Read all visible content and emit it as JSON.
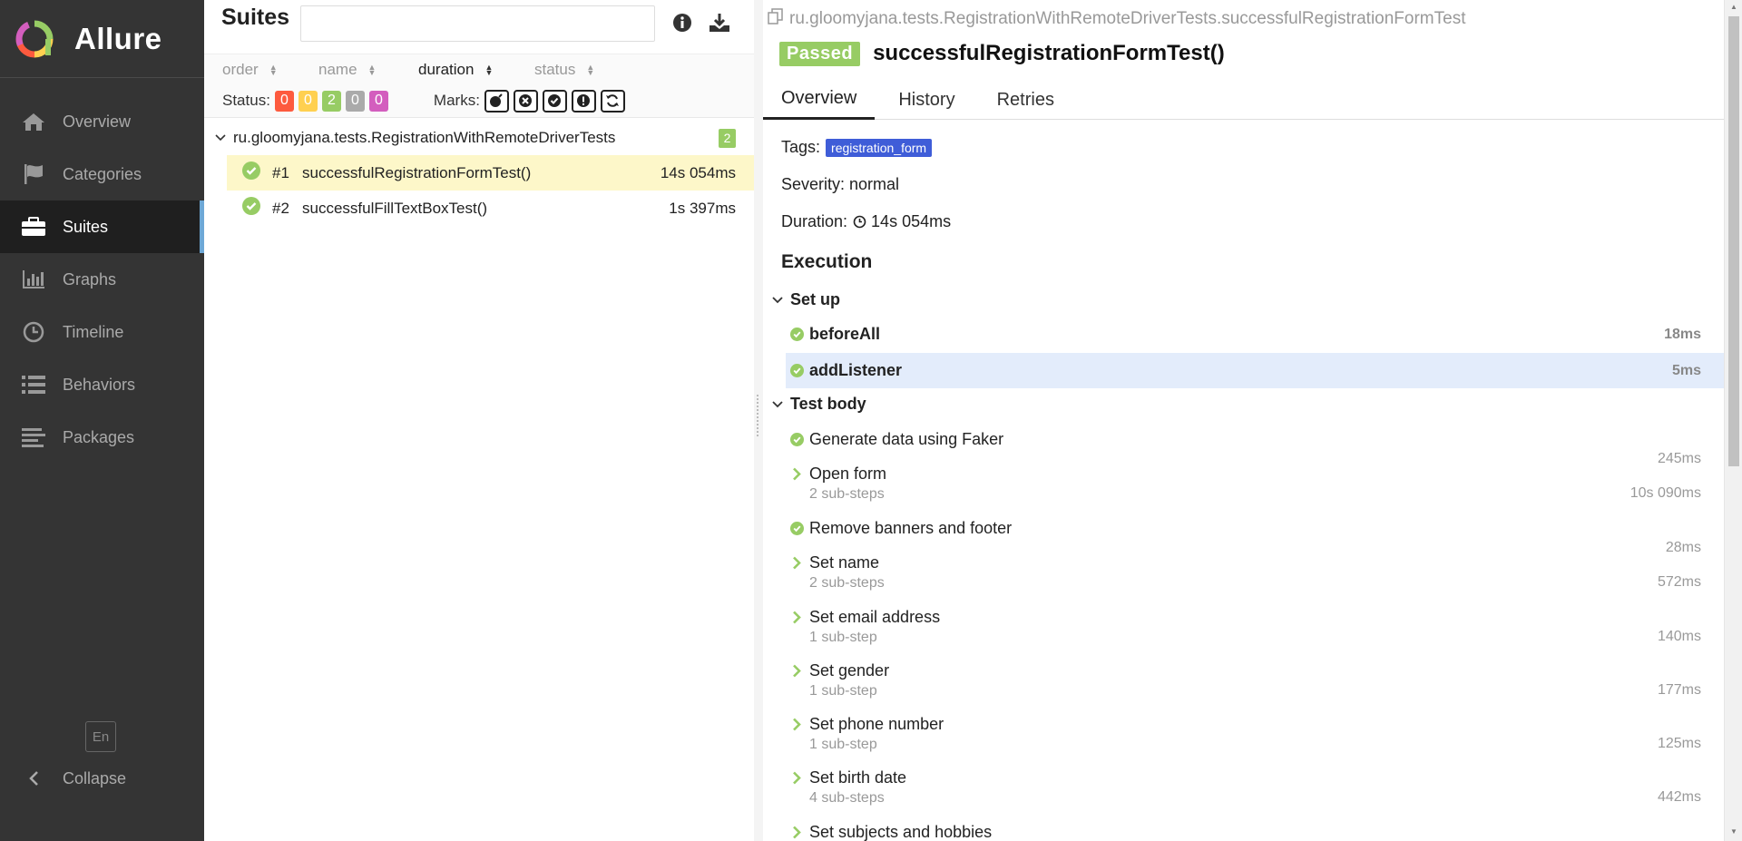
{
  "brand": {
    "name": "Allure"
  },
  "nav": [
    {
      "label": "Overview",
      "icon": "home-icon"
    },
    {
      "label": "Categories",
      "icon": "flag-icon"
    },
    {
      "label": "Suites",
      "icon": "briefcase-icon",
      "active": true
    },
    {
      "label": "Graphs",
      "icon": "bar-chart-icon"
    },
    {
      "label": "Timeline",
      "icon": "clock-icon"
    },
    {
      "label": "Behaviors",
      "icon": "list-icon"
    },
    {
      "label": "Packages",
      "icon": "align-left-icon"
    }
  ],
  "sidebar_footer": {
    "language": "En",
    "collapse": "Collapse"
  },
  "suites": {
    "title": "Suites",
    "sort": {
      "order": "order",
      "name": "name",
      "duration": "duration",
      "status": "status"
    },
    "status_label": "Status:",
    "status_counts": [
      "0",
      "0",
      "2",
      "0",
      "0"
    ],
    "marks_label": "Marks:",
    "group": {
      "name": "ru.gloomyjana.tests.RegistrationWithRemoteDriverTests",
      "count": "2"
    },
    "tests": [
      {
        "num": "#1",
        "name": "successfulRegistrationFormTest()",
        "duration": "14s 054ms"
      },
      {
        "num": "#2",
        "name": "successfulFillTextBoxTest()",
        "duration": "1s 397ms"
      }
    ]
  },
  "detail": {
    "crumb": "ru.gloomyjana.tests.RegistrationWithRemoteDriverTests.successfulRegistrationFormTest",
    "status": "Passed",
    "title": "successfulRegistrationFormTest()",
    "tabs": [
      "Overview",
      "History",
      "Retries"
    ],
    "tags_label": "Tags:",
    "tag": "registration_form",
    "severity": "Severity: normal",
    "duration_label": "Duration:",
    "duration": "14s 054ms",
    "execution": "Execution",
    "setup_label": "Set up",
    "setup": [
      {
        "name": "beforeAll",
        "duration": "18ms"
      },
      {
        "name": "addListener",
        "duration": "5ms"
      }
    ],
    "body_label": "Test body",
    "steps": [
      {
        "name": "Generate data using Faker",
        "sub": "",
        "duration": "245ms"
      },
      {
        "name": "Open form",
        "sub": "2 sub-steps",
        "duration": "10s 090ms"
      },
      {
        "name": "Remove banners and footer",
        "sub": "",
        "duration": "28ms"
      },
      {
        "name": "Set name",
        "sub": "2 sub-steps",
        "duration": "572ms"
      },
      {
        "name": "Set email address",
        "sub": "1 sub-step",
        "duration": "140ms"
      },
      {
        "name": "Set gender",
        "sub": "1 sub-step",
        "duration": "177ms"
      },
      {
        "name": "Set phone number",
        "sub": "1 sub-step",
        "duration": "125ms"
      },
      {
        "name": "Set birth date",
        "sub": "4 sub-steps",
        "duration": "442ms"
      },
      {
        "name": "Set subjects and hobbies",
        "sub": "",
        "duration": ""
      }
    ]
  },
  "colors": {
    "passed": "#97cc64",
    "failed": "#fd5a3e",
    "broken": "#ffd050",
    "skipped": "#aaaaaa",
    "unknown": "#d35ebe",
    "tag": "#3f5dd8"
  }
}
